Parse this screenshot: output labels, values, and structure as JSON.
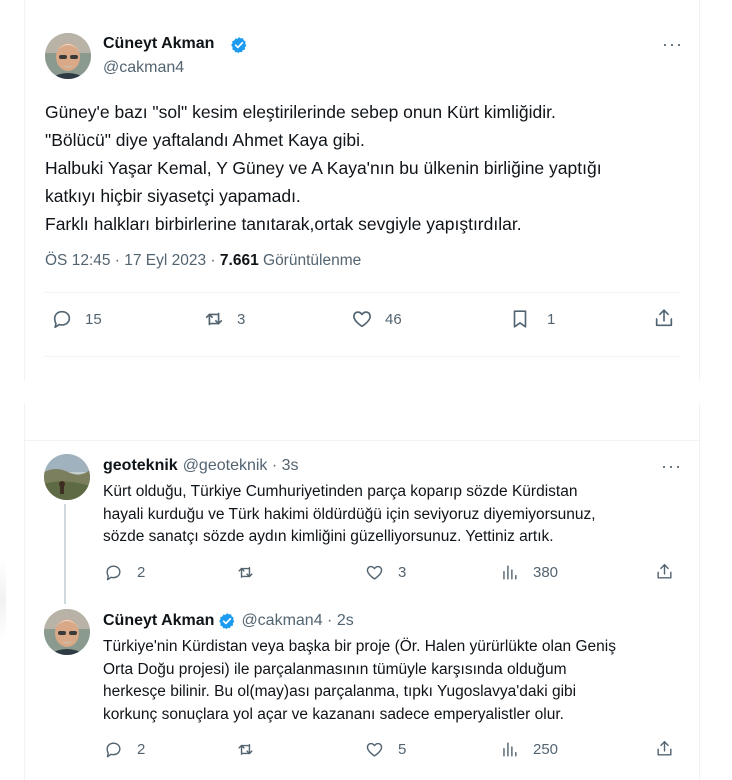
{
  "main_tweet": {
    "author_name": "Cüneyt Akman",
    "author_handle": "@cakman4",
    "more_label": "···",
    "text_lines": [
      "Güney'e bazı \"sol\" kesim eleştirilerinde sebep onun Kürt kimliğidir.",
      "\"Bölücü\" diye yaftalandı Ahmet Kaya gibi.",
      "Halbuki Yaşar Kemal, Y Güney ve A Kaya'nın bu ülkenin birliğine yaptığı",
      "katkıyı hiçbir siyasetçi yapamadı.",
      "Farklı halkları birbirlerine tanıtarak,ortak sevgiyle yapıştırdılar."
    ],
    "timestamp": "ÖS 12:45 · 17 Eyl 2023 · ",
    "views_count": "7.661",
    "views_label": " Görüntülenme",
    "replies": "15",
    "retweets": "3",
    "likes": "46",
    "bookmarks": "1"
  },
  "replies": [
    {
      "author_name": "geoteknik",
      "author_handle": "@geoteknik · 3s",
      "verified": false,
      "text_lines": [
        "Kürt olduğu, Türkiye Cumhuriyetinden parça koparıp sözde Kürdistan",
        "hayali kurduğu ve Türk hakimi öldürdüğü için seviyoruz diyemiyorsunuz,",
        "sözde sanatçı sözde aydın kimliğini güzelliyorsunuz. Yettiniz artık."
      ],
      "replies": "2",
      "retweets": "",
      "likes": "3",
      "views": "380"
    },
    {
      "author_name": "Cüneyt Akman",
      "author_handle": "@cakman4 · 2s",
      "verified": true,
      "text_lines": [
        "Türkiye'nin Kürdistan veya başka bir proje (Ör. Halen yürürlükte olan Geniş",
        "Orta Doğu projesi) ile parçalanmasının tümüyle karşısında olduğum",
        "herkesçe bilinir. Bu ol(may)ası parçalanma, tıpkı Yugoslavya'daki gibi",
        "korkunç sonuçlara yol açar ve kazananı sadece emperyalistler olur."
      ],
      "replies": "2",
      "retweets": "",
      "likes": "5",
      "views": "250"
    }
  ],
  "colors": {
    "verified_blue": "#1d9bf0",
    "muted": "#536471",
    "text": "#0f1419",
    "divider": "#eff3f4"
  }
}
